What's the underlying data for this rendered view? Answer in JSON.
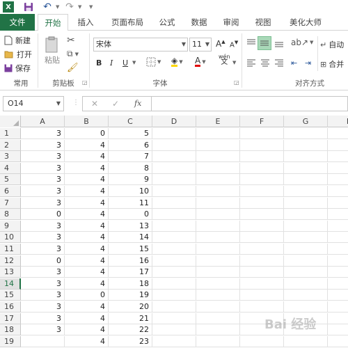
{
  "quick_access": {
    "logo_text": "X",
    "icons": [
      "excel-logo-icon",
      "save-icon",
      "undo-icon",
      "redo-icon"
    ]
  },
  "tabs": [
    {
      "label": "文件"
    },
    {
      "label": "开始"
    },
    {
      "label": "插入"
    },
    {
      "label": "页面布局"
    },
    {
      "label": "公式"
    },
    {
      "label": "数据"
    },
    {
      "label": "审阅"
    },
    {
      "label": "视图"
    },
    {
      "label": "美化大师"
    }
  ],
  "ribbon": {
    "common": {
      "new_label": "新建",
      "open_label": "打开",
      "save_label": "保存",
      "group_label": "常用"
    },
    "clipboard": {
      "paste_label": "粘贴",
      "group_label": "剪贴板"
    },
    "font": {
      "font_name": "宋体",
      "font_size": "11",
      "bold": "B",
      "italic": "I",
      "underline": "U",
      "group_label": "字体",
      "pinyin": "wén"
    },
    "alignment": {
      "group_label": "对齐方式",
      "wrap_label": "自动",
      "merge_label": "合并"
    }
  },
  "formula_bar": {
    "name_box": "O14",
    "cancel_symbol": "✕",
    "enter_symbol": "✓",
    "fx_symbol": "fx",
    "value": ""
  },
  "grid": {
    "columns": [
      "A",
      "B",
      "C",
      "D",
      "E",
      "F",
      "G",
      "H"
    ],
    "selected_row": 14,
    "rows": [
      {
        "row": "1",
        "A": "3",
        "B": "0",
        "C": "5"
      },
      {
        "row": "2",
        "A": "3",
        "B": "4",
        "C": "6"
      },
      {
        "row": "3",
        "A": "3",
        "B": "4",
        "C": "7"
      },
      {
        "row": "4",
        "A": "3",
        "B": "4",
        "C": "8"
      },
      {
        "row": "5",
        "A": "3",
        "B": "4",
        "C": "9"
      },
      {
        "row": "6",
        "A": "3",
        "B": "4",
        "C": "10"
      },
      {
        "row": "7",
        "A": "3",
        "B": "4",
        "C": "11"
      },
      {
        "row": "8",
        "A": "0",
        "B": "4",
        "C": "0"
      },
      {
        "row": "9",
        "A": "3",
        "B": "4",
        "C": "13"
      },
      {
        "row": "10",
        "A": "3",
        "B": "4",
        "C": "14"
      },
      {
        "row": "11",
        "A": "3",
        "B": "4",
        "C": "15"
      },
      {
        "row": "12",
        "A": "0",
        "B": "4",
        "C": "16"
      },
      {
        "row": "13",
        "A": "3",
        "B": "4",
        "C": "17"
      },
      {
        "row": "14",
        "A": "3",
        "B": "4",
        "C": "18"
      },
      {
        "row": "15",
        "A": "3",
        "B": "0",
        "C": "19"
      },
      {
        "row": "16",
        "A": "3",
        "B": "4",
        "C": "20"
      },
      {
        "row": "17",
        "A": "3",
        "B": "4",
        "C": "21"
      },
      {
        "row": "18",
        "A": "3",
        "B": "4",
        "C": "22"
      },
      {
        "row": "19",
        "A": "",
        "B": "4",
        "C": "23"
      }
    ]
  },
  "watermark_text": "Bai 经验",
  "colors": {
    "accent": "#217346",
    "header_bg": "#f3f3f3",
    "grid_line": "#e1e1e1"
  }
}
